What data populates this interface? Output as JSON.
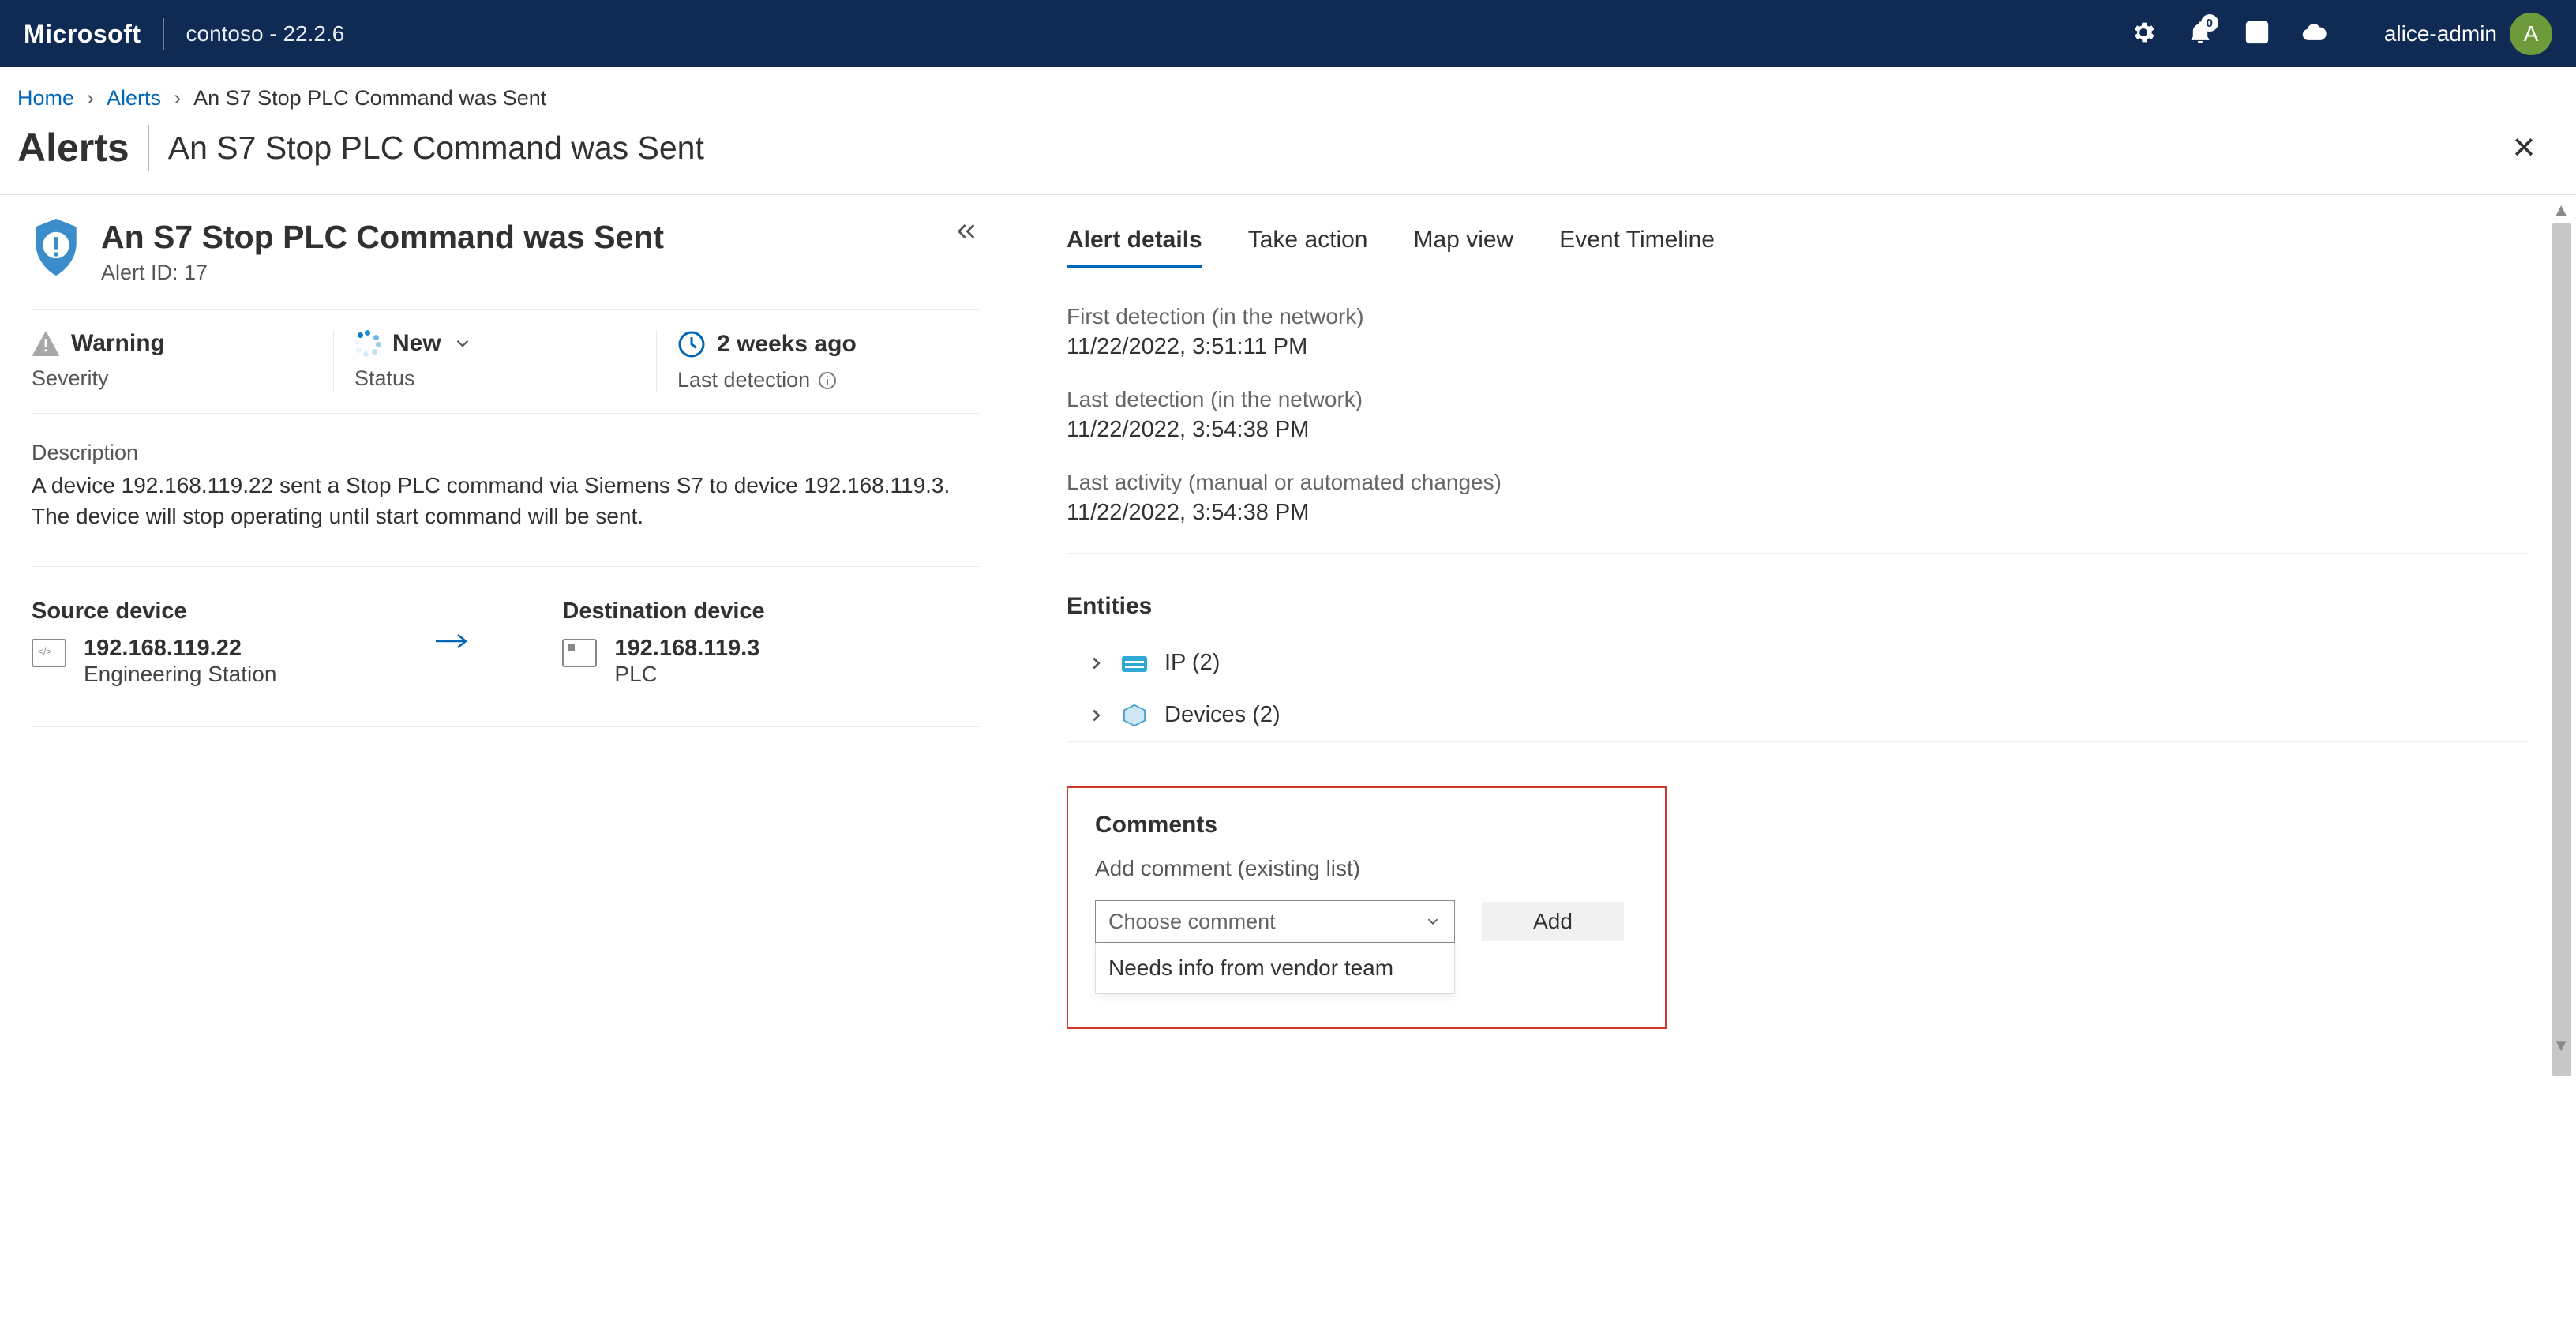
{
  "topbar": {
    "brand": "Microsoft",
    "tenant": "contoso - 22.2.6",
    "notif_count": "0",
    "user_name": "alice-admin",
    "user_initial": "A"
  },
  "breadcrumb": {
    "home": "Home",
    "alerts": "Alerts",
    "current": "An S7 Stop PLC Command was Sent"
  },
  "page": {
    "heading": "Alerts",
    "sub": "An S7 Stop PLC Command was Sent"
  },
  "alert": {
    "title": "An S7 Stop PLC Command was Sent",
    "id_label": "Alert ID: 17",
    "severity_value": "Warning",
    "severity_label": "Severity",
    "status_value": "New",
    "status_label": "Status",
    "last_detection_value": "2 weeks ago",
    "last_detection_label": "Last detection",
    "description_label": "Description",
    "description_text": "A device 192.168.119.22 sent a Stop PLC command via Siemens S7 to device 192.168.119.3. The device will stop operating until start command will be sent."
  },
  "devices": {
    "source_label": "Source device",
    "source_ip": "192.168.119.22",
    "source_type": "Engineering Station",
    "destination_label": "Destination device",
    "destination_ip": "192.168.119.3",
    "destination_type": "PLC"
  },
  "tabs": {
    "details": "Alert details",
    "action": "Take action",
    "map": "Map view",
    "timeline": "Event Timeline"
  },
  "details": {
    "first_label": "First detection (in the network)",
    "first_value": "11/22/2022, 3:51:11 PM",
    "last_label": "Last detection (in the network)",
    "last_value": "11/22/2022, 3:54:38 PM",
    "activity_label": "Last activity (manual or automated changes)",
    "activity_value": "11/22/2022, 3:54:38 PM"
  },
  "entities": {
    "heading": "Entities",
    "ip": "IP (2)",
    "devices": "Devices (2)"
  },
  "comments": {
    "heading": "Comments",
    "add_label": "Add comment (existing list)",
    "placeholder": "Choose comment",
    "option1": "Needs info from vendor team",
    "add_btn": "Add"
  }
}
